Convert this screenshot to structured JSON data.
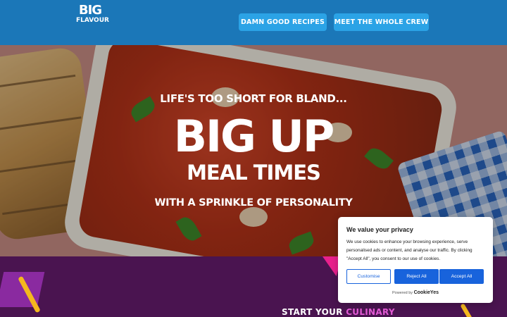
{
  "header": {
    "logo": {
      "line1": "BIG",
      "line2": "FLAVOUR"
    },
    "nav": [
      {
        "label": "DAMN GOOD RECIPES"
      },
      {
        "label": "MEET THE WHOLE CREW"
      }
    ]
  },
  "hero": {
    "tagline_top": "LIFE'S TOO SHORT FOR BLAND...",
    "headline_big": "BIG UP",
    "headline_mid": "MEAL TIMES",
    "tagline_bottom": "WITH A SPRINKLE OF PERSONALITY"
  },
  "section": {
    "title_part1": "START YOUR ",
    "title_accent": "CULINARY"
  },
  "cookie_banner": {
    "title": "We value your privacy",
    "text": "We use cookies to enhance your browsing experience, serve personalised ads or content, and analyse our traffic. By clicking \"Accept All\", you consent to our use of cookies.",
    "buttons": {
      "customise": "Customise",
      "reject": "Reject All",
      "accept": "Accept All"
    },
    "powered_by": "Powered by",
    "brand": "CookieYes"
  },
  "colors": {
    "header_bg": "#1b77b8",
    "nav_button_bg": "#2ba3e6",
    "bottom_bg": "#4a1450",
    "accent_pink": "#e25ad4",
    "cookie_blue": "#1863dc"
  }
}
